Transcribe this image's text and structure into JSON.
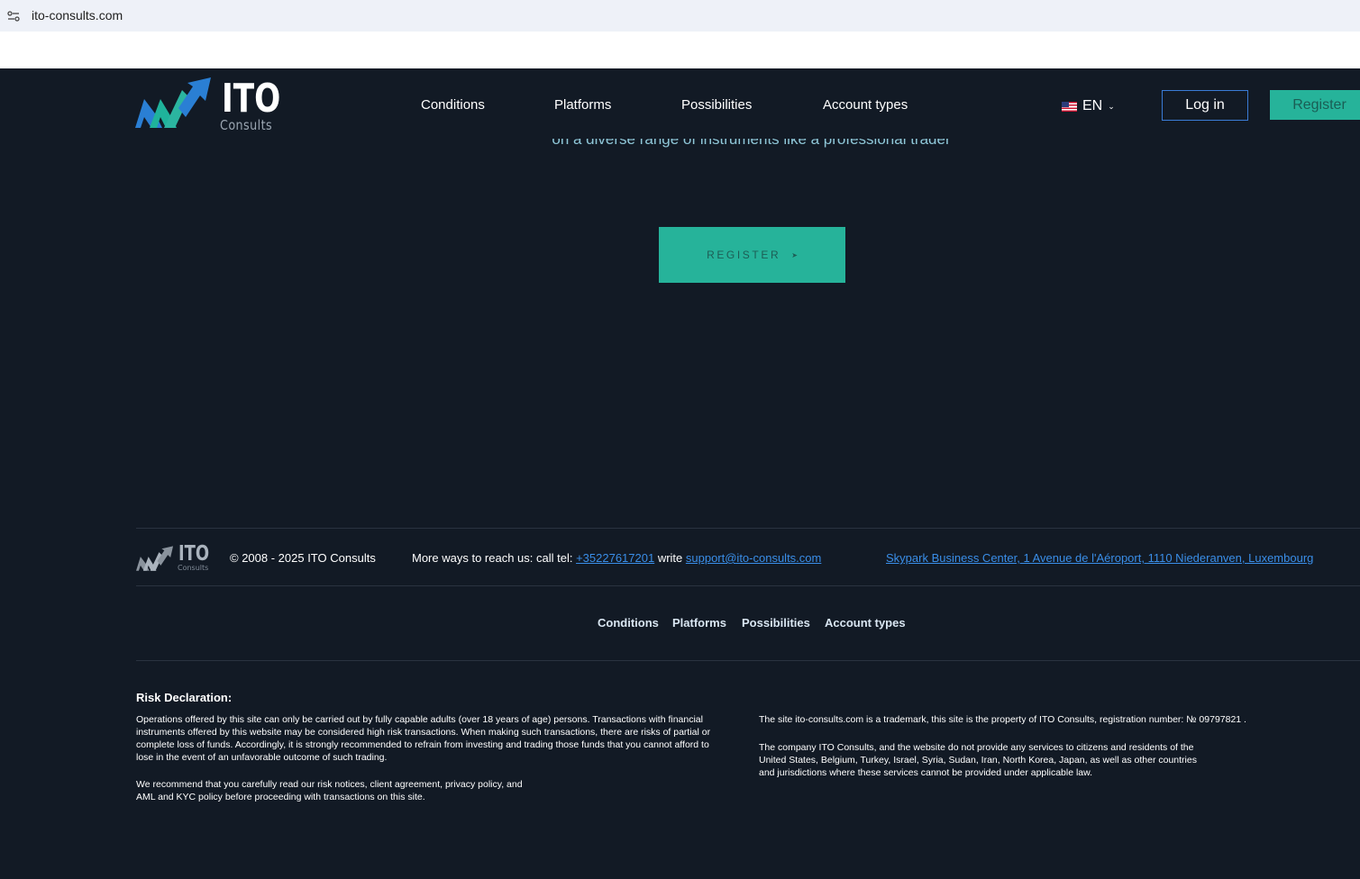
{
  "browser": {
    "url": "ito-consults.com"
  },
  "header": {
    "logo_title": "ITO",
    "logo_subtitle": "Consults",
    "nav": [
      "Conditions",
      "Platforms",
      "Possibilities",
      "Account types"
    ],
    "language": "EN",
    "login_label": "Log in",
    "register_label": "Register"
  },
  "hero": {
    "subtitle": "on a diverse range of instruments like a professional trader",
    "cta_label": "REGISTER"
  },
  "footer": {
    "logo_title": "ITO",
    "logo_subtitle": "Consults",
    "copyright": "© 2008 - 2025 ITO Consults",
    "contact_prefix": "More ways to reach us:  call tel: ",
    "phone": "+35227617201",
    "write_label": " write ",
    "email": "support@ito-consults.com",
    "address": "Skypark Business Center, 1 Avenue de l'Aéroport, 1110 Niederanven, Luxembourg",
    "nav": [
      "Conditions",
      "Platforms",
      "Possibilities",
      "Account types"
    ],
    "risk_title": "Risk Declaration:",
    "risk_p1": "Operations offered by this site can only be carried out by fully capable adults (over 18 years of age) persons. Transactions with financial instruments offered by this website may be considered high risk transactions. When making such transactions, there are risks of partial or complete loss of funds. Accordingly, it is strongly recommended to refrain from investing and trading those funds that you cannot afford to lose in the event of an unfavorable outcome of such trading.",
    "risk_p2": "We recommend that you carefully read our risk notices, client agreement, privacy policy, and AML and KYC policy before proceeding with transactions on this site.",
    "trademark_note": "The site ito-consults.com is a trademark, this site is the property of ITO Consults, registration number: № 09797821 .",
    "restriction_note": "The company ITO Consults, and the website do not provide any services to citizens and residents of the United States, Belgium, Turkey, Israel, Syria, Sudan, Iran, North Korea, Japan, as well as other countries and jurisdictions where these services cannot be provided under applicable law."
  },
  "colors": {
    "background": "#121a25",
    "accent_teal": "#26b39a",
    "link_blue": "#3a8ee8"
  },
  "icons": [
    "site-info-icon",
    "us-flag-icon",
    "chevron-down-icon",
    "arrow-right-icon",
    "ito-logo"
  ]
}
